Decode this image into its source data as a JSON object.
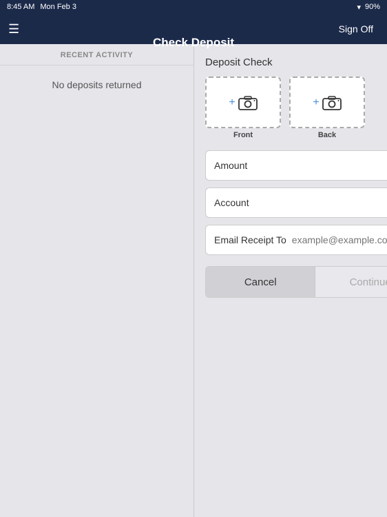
{
  "status_bar": {
    "time": "8:45 AM",
    "date": "Mon Feb 3",
    "wifi": "WiFi",
    "battery": "90%"
  },
  "nav": {
    "title": "Check Deposit",
    "sign_off_label": "Sign Off",
    "hamburger_label": "☰"
  },
  "left_panel": {
    "section_header": "RECENT ACTIVITY",
    "empty_message": "No deposits returned"
  },
  "right_panel": {
    "title": "Deposit Check",
    "front_label": "Front",
    "back_label": "Back",
    "amount_label": "Amount",
    "account_label": "Account",
    "email_label": "Email Receipt To",
    "email_placeholder": "example@example.com",
    "cancel_label": "Cancel",
    "continue_label": "Continue"
  }
}
